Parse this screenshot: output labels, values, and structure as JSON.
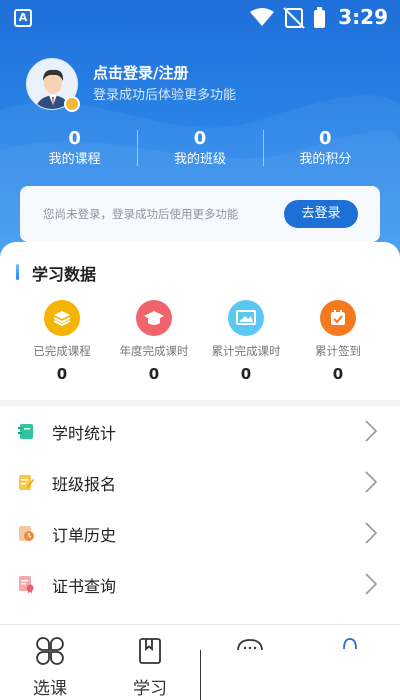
{
  "status_bar": {
    "time": "3:29",
    "app_badge": "A"
  },
  "profile": {
    "title": "点击登录/注册",
    "subtitle": "登录成功后体验更多功能"
  },
  "stats": [
    {
      "value": "0",
      "label": "我的课程"
    },
    {
      "value": "0",
      "label": "我的班级"
    },
    {
      "value": "0",
      "label": "我的积分"
    }
  ],
  "login_card": {
    "text": "您尚未登录，登录成功后使用更多功能",
    "button": "去登录"
  },
  "study": {
    "title": "学习数据",
    "metrics": [
      {
        "label": "已完成课程",
        "value": "0",
        "icon": "layers-icon",
        "color": "#f5b400"
      },
      {
        "label": "年度完成课时",
        "value": "0",
        "icon": "graduation-cap-icon",
        "color": "#f0646e"
      },
      {
        "label": "累计完成课时",
        "value": "0",
        "icon": "image-screen-icon",
        "color": "#5ac8f0"
      },
      {
        "label": "累计签到",
        "value": "0",
        "icon": "calendar-check-icon",
        "color": "#f57a1f"
      }
    ]
  },
  "menu": [
    {
      "label": "学时统计",
      "icon": "notebook-icon",
      "color": "#2fc4a0"
    },
    {
      "label": "班级报名",
      "icon": "edit-note-icon",
      "color": "#f0b93a"
    },
    {
      "label": "订单历史",
      "icon": "order-clock-icon",
      "color": "#f08a3a"
    },
    {
      "label": "证书查询",
      "icon": "certificate-icon",
      "color": "#e8606a"
    }
  ],
  "tabs": [
    {
      "label": "选课",
      "icon": "grid-petals-icon"
    },
    {
      "label": "学习",
      "icon": "bookmark-book-icon"
    }
  ],
  "colors": {
    "accent": "#1e6fd6",
    "header_top": "#1f6fd9",
    "header_bottom": "#3a98f0"
  }
}
